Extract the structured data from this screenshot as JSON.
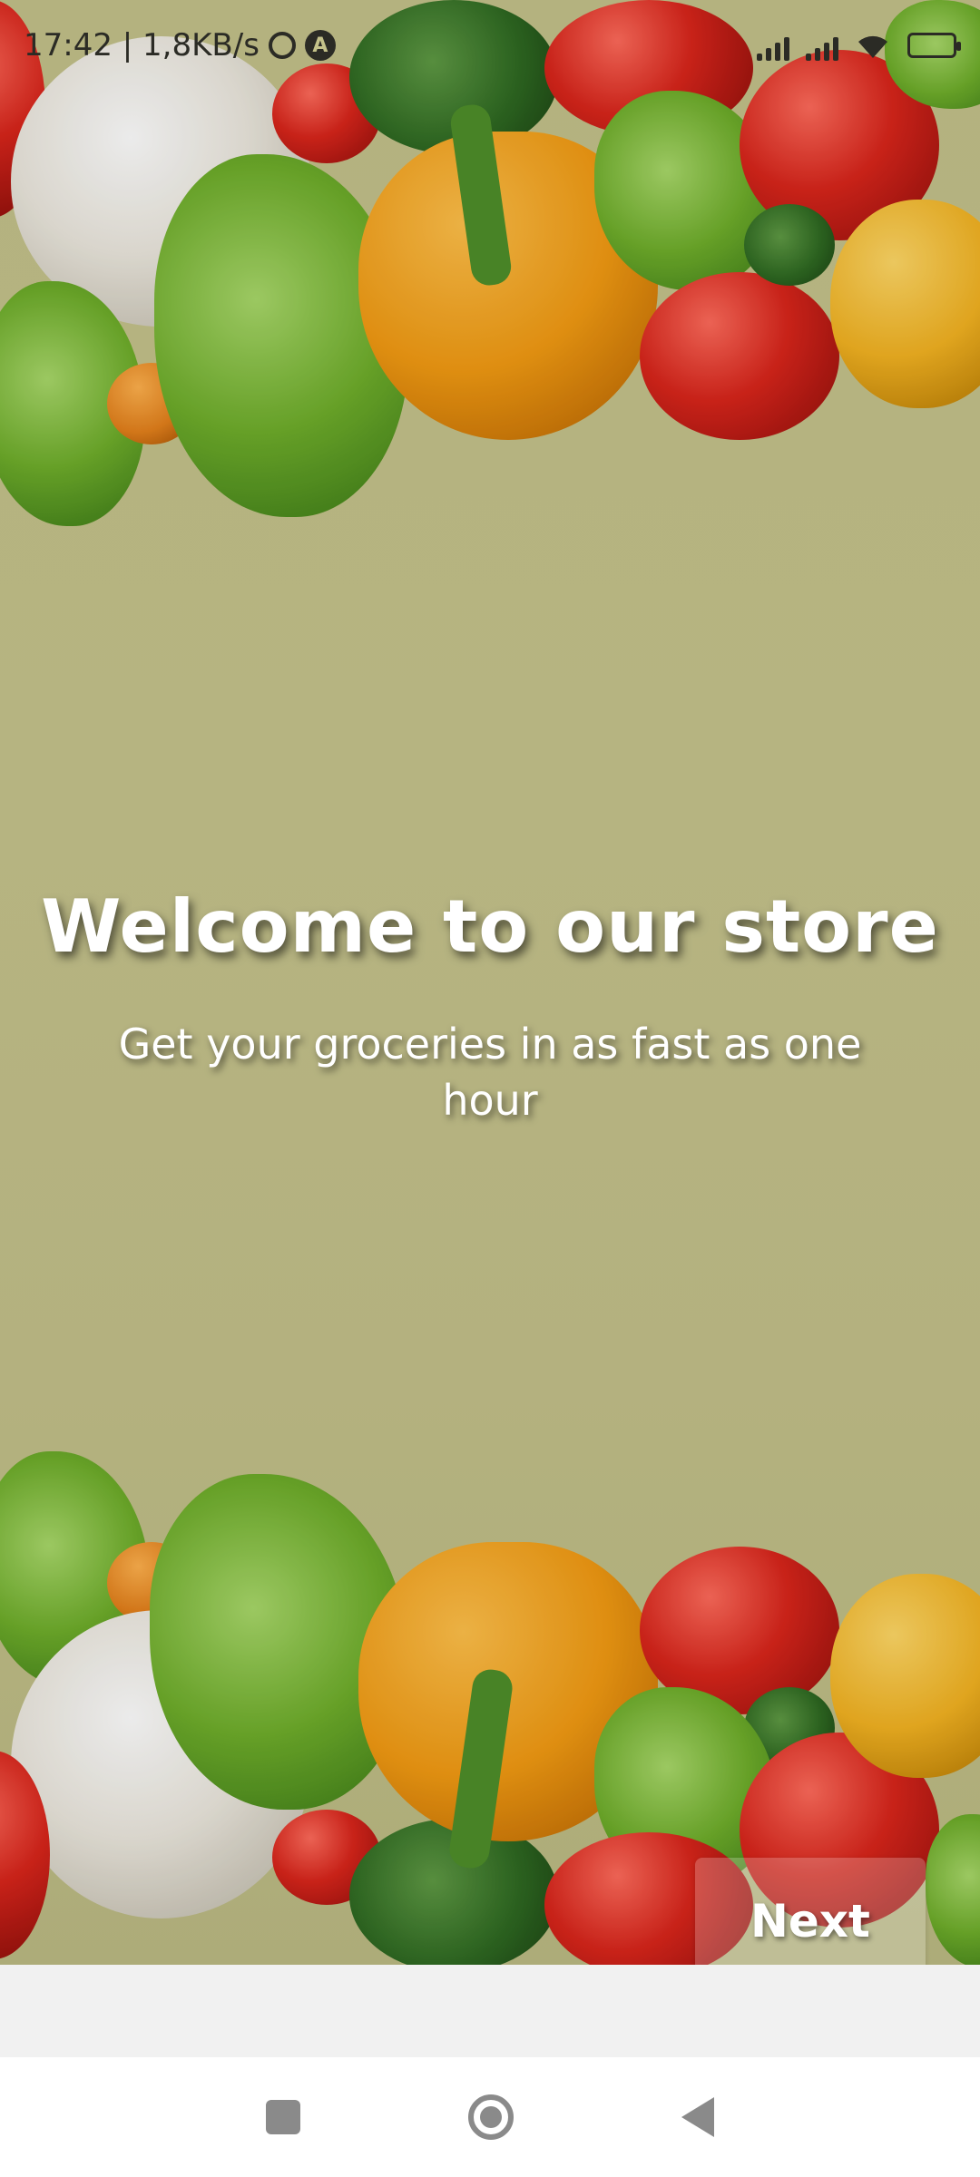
{
  "status_bar": {
    "time_speed": "17:42 | 1,8KB/s",
    "a_badge": "A"
  },
  "main": {
    "title": "Welcome to our store",
    "subtitle": "Get your groceries in as fast as one hour"
  },
  "buttons": {
    "next_label": "Next"
  },
  "nav": {
    "recents_icon": "square-icon",
    "home_icon": "circle-home-icon",
    "back_icon": "triangle-back-icon"
  },
  "colors": {
    "background": "#c4c28a",
    "text": "#ffffff"
  }
}
